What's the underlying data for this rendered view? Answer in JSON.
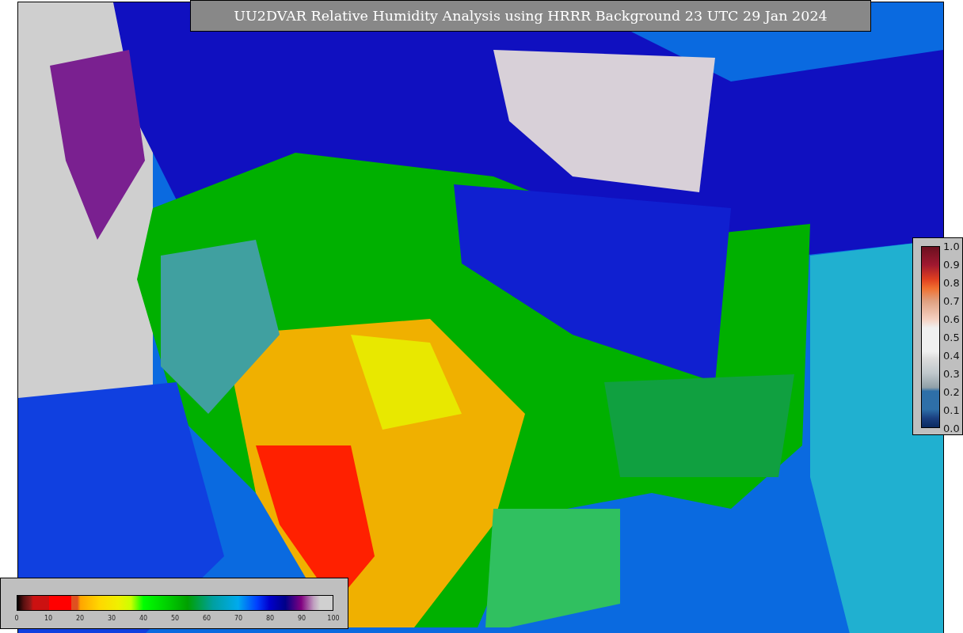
{
  "title": "UU2DVAR Relative Humidity Analysis using HRRR Background 23 UTC 29 Jan 2024",
  "observation_colorbar": {
    "ticks": [
      "1.0",
      "0.9",
      "0.8",
      "0.7",
      "0.6",
      "0.5",
      "0.4",
      "0.3",
      "0.2",
      "0.1",
      "0.0"
    ]
  },
  "humidity_colorbar": {
    "ticks": [
      "0",
      "10",
      "20",
      "30",
      "40",
      "50",
      "60",
      "70",
      "80",
      "90",
      "100"
    ]
  }
}
